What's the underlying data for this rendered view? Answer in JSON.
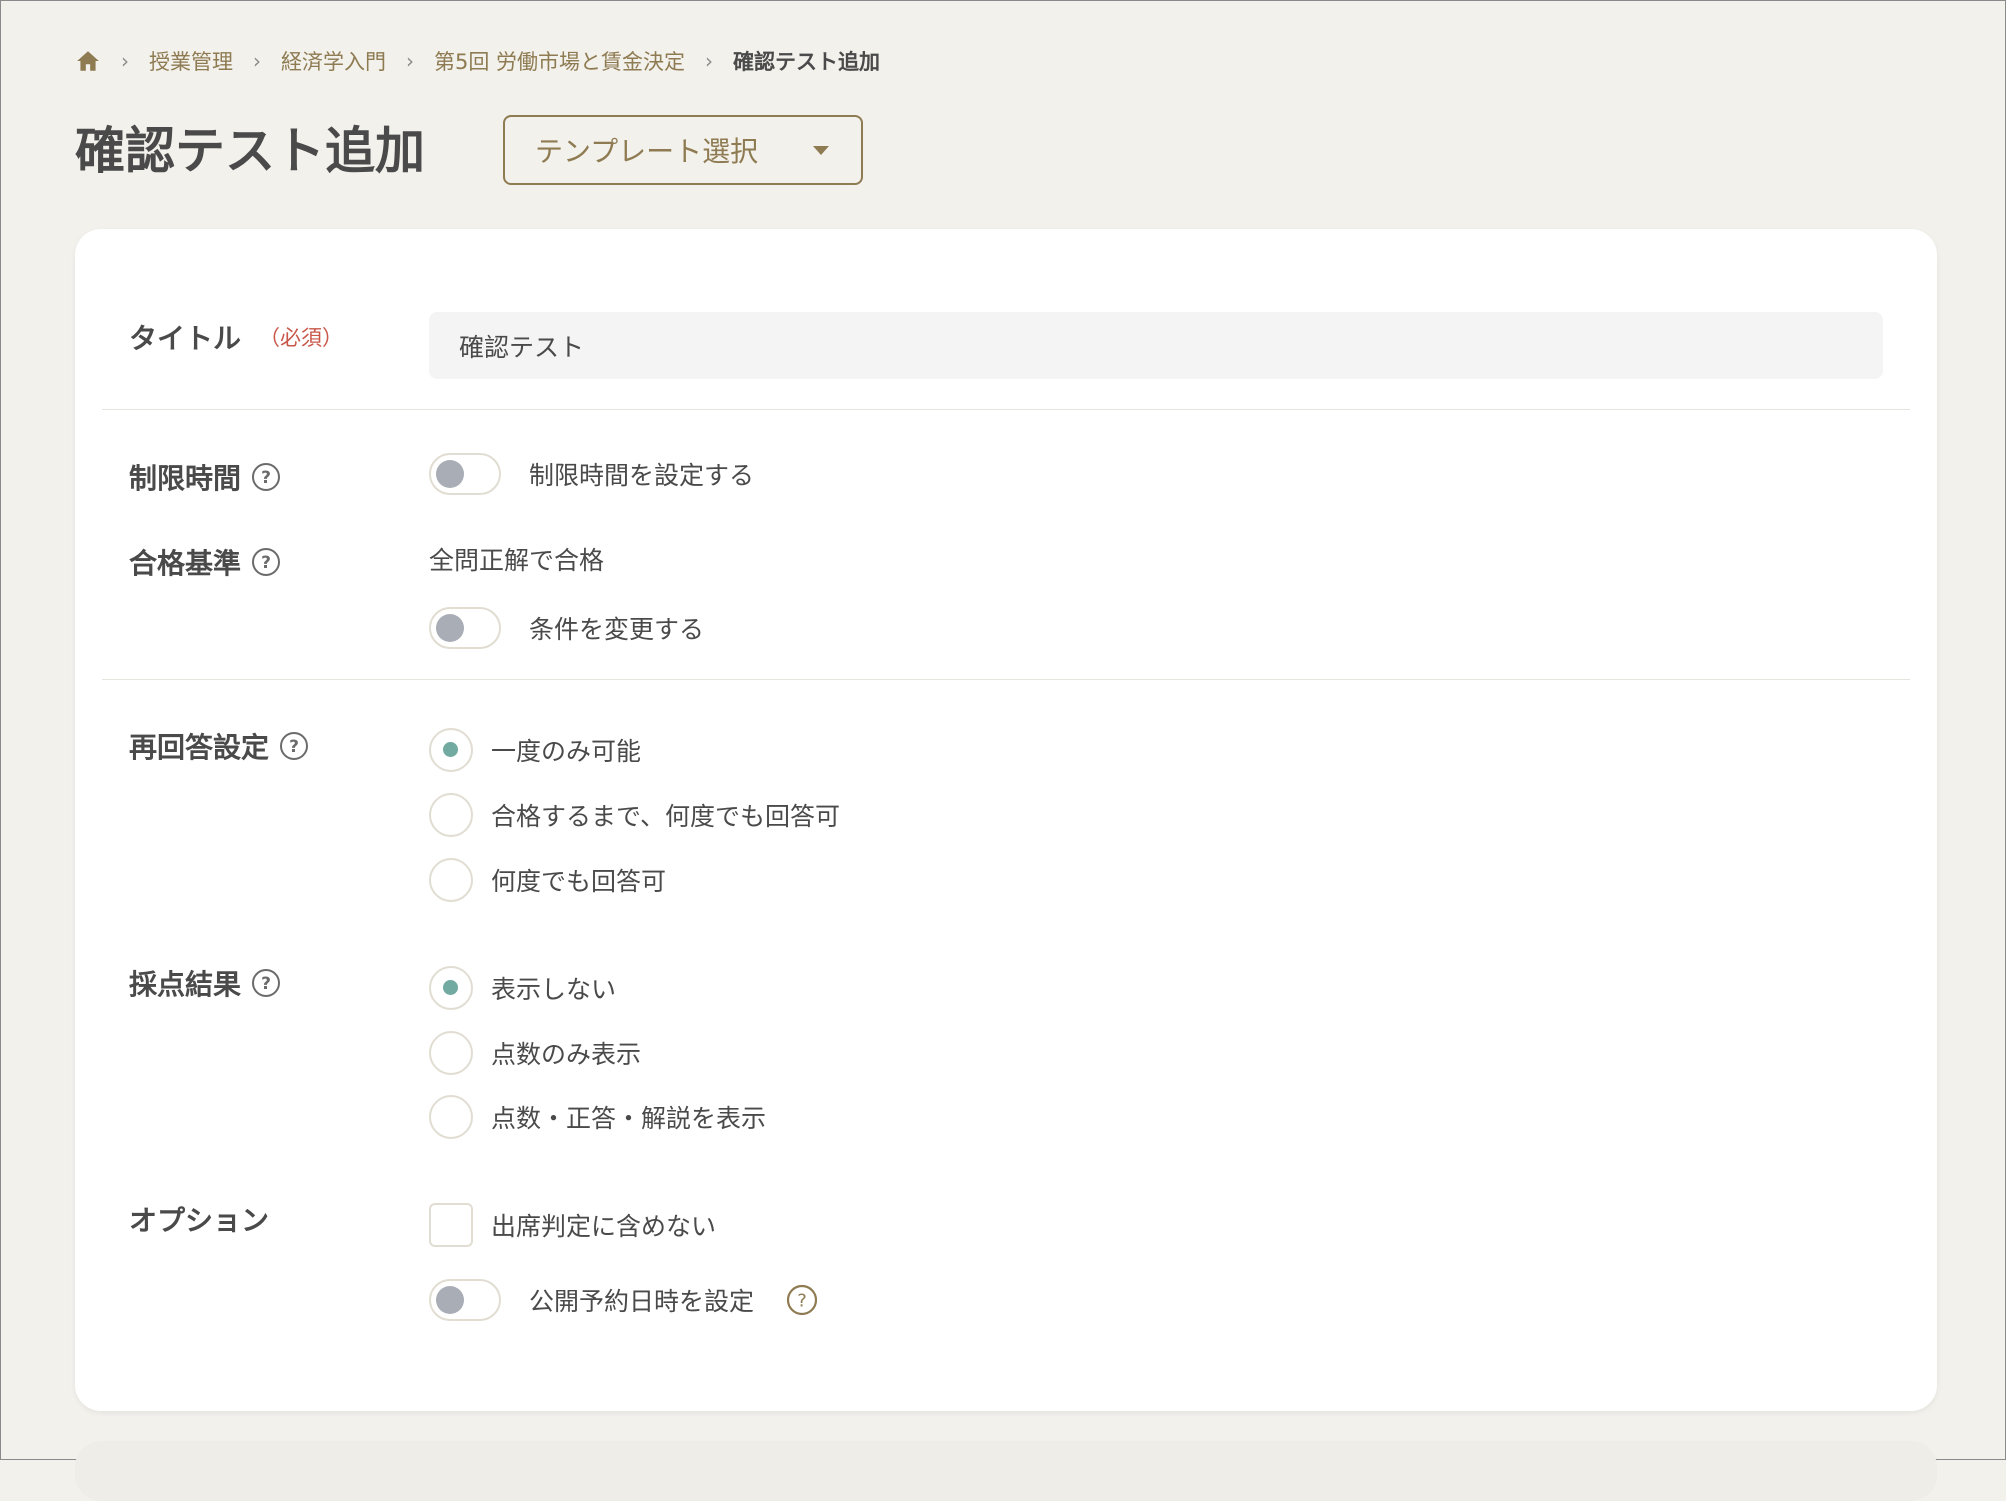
{
  "breadcrumb": {
    "home_icon": "home-icon",
    "items": [
      "授業管理",
      "経済学入門",
      "第5回 労働市場と賃金決定"
    ],
    "current": "確認テスト追加",
    "separator": "›"
  },
  "page_title": "確認テスト追加",
  "template_select": {
    "label": "テンプレート選択",
    "icon": "caret-down-icon"
  },
  "form": {
    "title": {
      "label": "タイトル",
      "required_label": "（必須）",
      "value": "確認テスト"
    },
    "time_limit": {
      "label": "制限時間",
      "toggle_label": "制限時間を設定する",
      "enabled": false
    },
    "pass_criteria": {
      "label": "合格基準",
      "value_text": "全問正解で合格",
      "toggle_label": "条件を変更する",
      "enabled": false
    },
    "reanswer": {
      "label": "再回答設定",
      "options": [
        "一度のみ可能",
        "合格するまで、何度でも回答可",
        "何度でも回答可"
      ],
      "selected_index": 0
    },
    "grading_result": {
      "label": "採点結果",
      "options": [
        "表示しない",
        "点数のみ表示",
        "点数・正答・解説を表示"
      ],
      "selected_index": 0
    },
    "options": {
      "label": "オプション",
      "checkbox_label": "出席判定に含めない",
      "checkbox_checked": false,
      "schedule_toggle_label": "公開予約日時を設定",
      "schedule_enabled": false
    }
  },
  "colors": {
    "background": "#f3f1ec",
    "accent_gold": "#8e7b52",
    "radio_selected": "#72a9a1",
    "required_red": "#c9574a",
    "toggle_knob_off": "#a8adb6"
  }
}
